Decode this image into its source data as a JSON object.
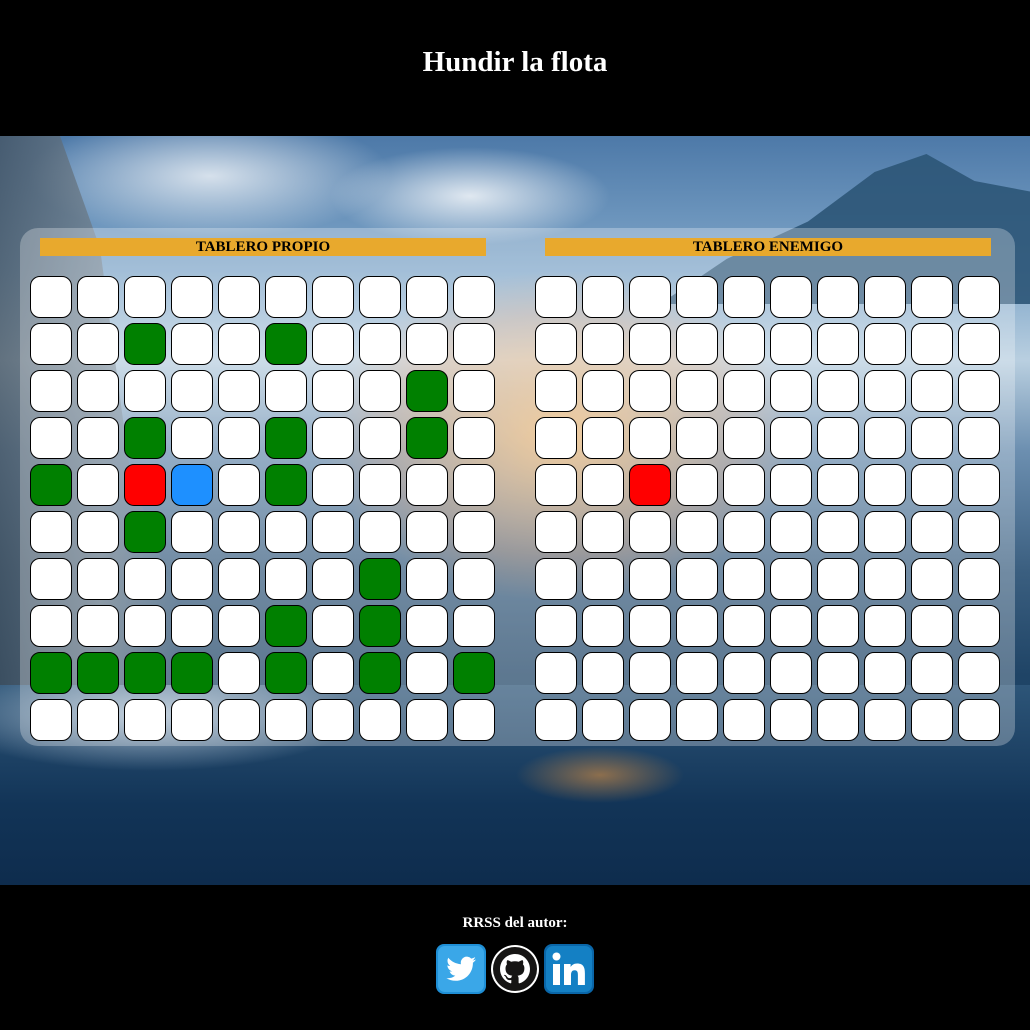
{
  "header": {
    "title": "Hundir la flota"
  },
  "boards": {
    "own": {
      "title": "TABLERO PROPIO",
      "rows": [
        [
          "empty",
          "empty",
          "empty",
          "empty",
          "empty",
          "empty",
          "empty",
          "empty",
          "empty",
          "empty"
        ],
        [
          "empty",
          "empty",
          "ship",
          "empty",
          "empty",
          "ship",
          "empty",
          "empty",
          "empty",
          "empty"
        ],
        [
          "empty",
          "empty",
          "empty",
          "empty",
          "empty",
          "empty",
          "empty",
          "empty",
          "ship",
          "empty"
        ],
        [
          "empty",
          "empty",
          "ship",
          "empty",
          "empty",
          "ship",
          "empty",
          "empty",
          "ship",
          "empty"
        ],
        [
          "ship",
          "empty",
          "hit",
          "miss",
          "empty",
          "ship",
          "empty",
          "empty",
          "empty",
          "empty"
        ],
        [
          "empty",
          "empty",
          "ship",
          "empty",
          "empty",
          "empty",
          "empty",
          "empty",
          "empty",
          "empty"
        ],
        [
          "empty",
          "empty",
          "empty",
          "empty",
          "empty",
          "empty",
          "empty",
          "ship",
          "empty",
          "empty"
        ],
        [
          "empty",
          "empty",
          "empty",
          "empty",
          "empty",
          "ship",
          "empty",
          "ship",
          "empty",
          "empty"
        ],
        [
          "ship",
          "ship",
          "ship",
          "ship",
          "empty",
          "ship",
          "empty",
          "ship",
          "empty",
          "ship"
        ],
        [
          "empty",
          "empty",
          "empty",
          "empty",
          "empty",
          "empty",
          "empty",
          "empty",
          "empty",
          "empty"
        ]
      ]
    },
    "enemy": {
      "title": "TABLERO ENEMIGO",
      "rows": [
        [
          "empty",
          "empty",
          "empty",
          "empty",
          "empty",
          "empty",
          "empty",
          "empty",
          "empty",
          "empty"
        ],
        [
          "empty",
          "empty",
          "empty",
          "empty",
          "empty",
          "empty",
          "empty",
          "empty",
          "empty",
          "empty"
        ],
        [
          "empty",
          "empty",
          "empty",
          "empty",
          "empty",
          "empty",
          "empty",
          "empty",
          "empty",
          "empty"
        ],
        [
          "empty",
          "empty",
          "empty",
          "empty",
          "empty",
          "empty",
          "empty",
          "empty",
          "empty",
          "empty"
        ],
        [
          "empty",
          "empty",
          "hit",
          "empty",
          "empty",
          "empty",
          "empty",
          "empty",
          "empty",
          "empty"
        ],
        [
          "empty",
          "empty",
          "empty",
          "empty",
          "empty",
          "empty",
          "empty",
          "empty",
          "empty",
          "empty"
        ],
        [
          "empty",
          "empty",
          "empty",
          "empty",
          "empty",
          "empty",
          "empty",
          "empty",
          "empty",
          "empty"
        ],
        [
          "empty",
          "empty",
          "empty",
          "empty",
          "empty",
          "empty",
          "empty",
          "empty",
          "empty",
          "empty"
        ],
        [
          "empty",
          "empty",
          "empty",
          "empty",
          "empty",
          "empty",
          "empty",
          "empty",
          "empty",
          "empty"
        ],
        [
          "empty",
          "empty",
          "empty",
          "empty",
          "empty",
          "empty",
          "empty",
          "empty",
          "empty",
          "empty"
        ]
      ]
    }
  },
  "colors": {
    "ship": "#008000",
    "hit": "#ff0000",
    "miss": "#1e90ff",
    "empty": "#ffffff",
    "title_bar": "#e8a92d"
  },
  "footer": {
    "label": "RRSS del autor:",
    "socials": [
      {
        "icon": "twitter-icon"
      },
      {
        "icon": "github-icon"
      },
      {
        "icon": "linkedin-icon"
      }
    ]
  }
}
